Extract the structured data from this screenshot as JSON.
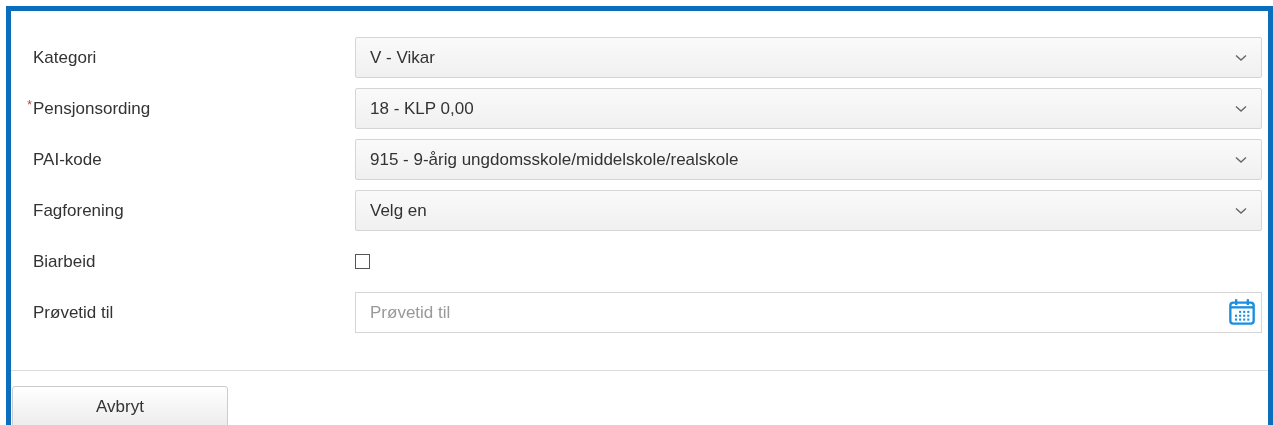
{
  "form": {
    "fields": [
      {
        "kind": "select",
        "label": "Kategori",
        "value": "V - Vikar"
      },
      {
        "kind": "select",
        "label": "Pensjonsording",
        "required_marker": "*",
        "value": "18 - KLP 0,00"
      },
      {
        "kind": "select",
        "label": "PAI-kode",
        "value": "915 - 9-årig ungdomsskole/middelskole/realskole"
      },
      {
        "kind": "select",
        "label": "Fagforening",
        "value": "Velg en"
      },
      {
        "kind": "checkbox",
        "label": "Biarbeid",
        "checked": false
      },
      {
        "kind": "date",
        "label": "Prøvetid til",
        "placeholder": "Prøvetid til"
      }
    ]
  },
  "buttons": [
    "Avbryt"
  ]
}
